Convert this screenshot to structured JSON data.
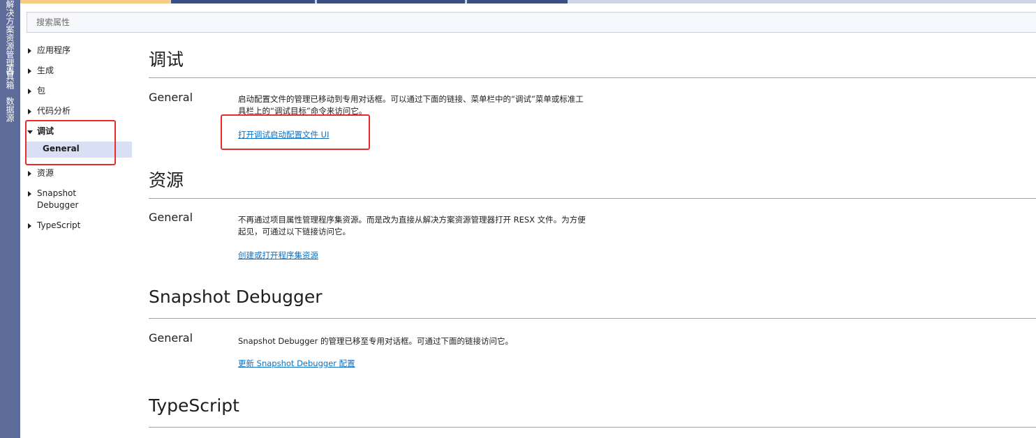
{
  "toolstrip": {
    "tabs": [
      "解决方案资源管理器",
      "工具箱",
      "数据源"
    ]
  },
  "search": {
    "placeholder": "搜索属性"
  },
  "nav": {
    "items": [
      {
        "label": "应用程序"
      },
      {
        "label": "生成"
      },
      {
        "label": "包"
      },
      {
        "label": "代码分析"
      },
      {
        "label": "调试",
        "expanded": true,
        "children": [
          {
            "label": "General",
            "selected": true
          }
        ]
      },
      {
        "label": "资源"
      },
      {
        "label": "Snapshot Debugger"
      },
      {
        "label": "TypeScript"
      }
    ]
  },
  "sections": [
    {
      "title": "调试",
      "group": "General",
      "description": "启动配置文件的管理已移动到专用对话框。可以通过下面的链接、菜单栏中的“调试”菜单或标准工具栏上的“调试目标”命令来访问它。",
      "link": "打开调试启动配置文件 UI"
    },
    {
      "title": "资源",
      "group": "General",
      "description": "不再通过项目属性管理程序集资源。而是改为直接从解决方案资源管理器打开 RESX 文件。为方便起见，可通过以下链接访问它。",
      "link": "创建或打开程序集资源"
    },
    {
      "title": "Snapshot Debugger",
      "group": "General",
      "description": "Snapshot Debugger 的管理已移至专用对话框。可通过下面的链接访问它。",
      "link": "更新 Snapshot Debugger 配置"
    },
    {
      "title": "TypeScript"
    }
  ],
  "colors": {
    "toolstrip": "#5d6b99",
    "link": "#0e70c0",
    "highlight": "#e82b2b",
    "selected": "#d9dff5"
  }
}
